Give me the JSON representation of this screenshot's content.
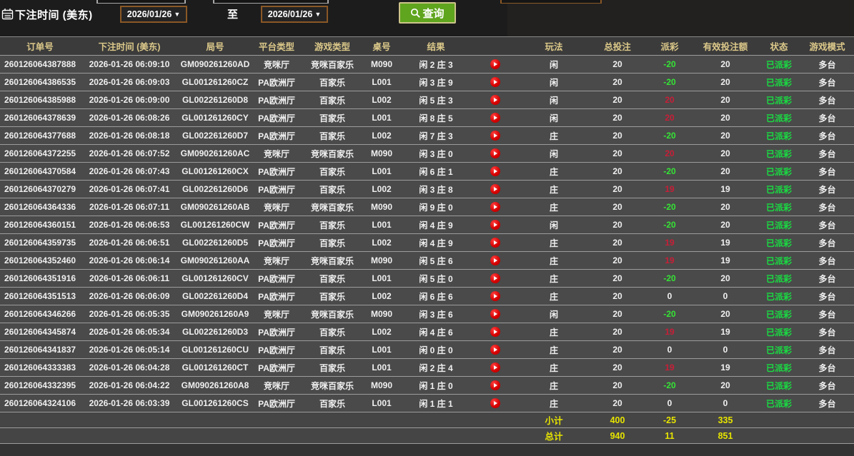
{
  "toolbar": {
    "label": "下注时间 (美东)",
    "date_from": "2026/01/26",
    "date_to": "2026/01/26",
    "to_label": "至",
    "search_label": "查询",
    "dropdown_arrow": "▼"
  },
  "table": {
    "headers": [
      "订单号",
      "下注时间 (美东)",
      "局号",
      "平台类型",
      "游戏类型",
      "桌号",
      "结果",
      "",
      "玩法",
      "总投注",
      "派彩",
      "有效投注额",
      "状态",
      "游戏模式"
    ],
    "rows": [
      [
        "260126064387888",
        "2026-01-26 06:09:10",
        "GM090261260AD",
        "竞咪厅",
        "竞咪百家乐",
        "M090",
        "闲 2 庄 3",
        "闲",
        "20",
        "-20",
        "20",
        "已派彩",
        "多台"
      ],
      [
        "260126064386535",
        "2026-01-26 06:09:03",
        "GL001261260CZ",
        "PA欧洲厅",
        "百家乐",
        "L001",
        "闲 3 庄 9",
        "闲",
        "20",
        "-20",
        "20",
        "已派彩",
        "多台"
      ],
      [
        "260126064385988",
        "2026-01-26 06:09:00",
        "GL002261260D8",
        "PA欧洲厅",
        "百家乐",
        "L002",
        "闲 5 庄 3",
        "闲",
        "20",
        "20",
        "20",
        "已派彩",
        "多台"
      ],
      [
        "260126064378639",
        "2026-01-26 06:08:26",
        "GL001261260CY",
        "PA欧洲厅",
        "百家乐",
        "L001",
        "闲 8 庄 5",
        "闲",
        "20",
        "20",
        "20",
        "已派彩",
        "多台"
      ],
      [
        "260126064377688",
        "2026-01-26 06:08:18",
        "GL002261260D7",
        "PA欧洲厅",
        "百家乐",
        "L002",
        "闲 7 庄 3",
        "庄",
        "20",
        "-20",
        "20",
        "已派彩",
        "多台"
      ],
      [
        "260126064372255",
        "2026-01-26 06:07:52",
        "GM090261260AC",
        "竞咪厅",
        "竞咪百家乐",
        "M090",
        "闲 3 庄 0",
        "闲",
        "20",
        "20",
        "20",
        "已派彩",
        "多台"
      ],
      [
        "260126064370584",
        "2026-01-26 06:07:43",
        "GL001261260CX",
        "PA欧洲厅",
        "百家乐",
        "L001",
        "闲 6 庄 1",
        "庄",
        "20",
        "-20",
        "20",
        "已派彩",
        "多台"
      ],
      [
        "260126064370279",
        "2026-01-26 06:07:41",
        "GL002261260D6",
        "PA欧洲厅",
        "百家乐",
        "L002",
        "闲 3 庄 8",
        "庄",
        "20",
        "19",
        "19",
        "已派彩",
        "多台"
      ],
      [
        "260126064364336",
        "2026-01-26 06:07:11",
        "GM090261260AB",
        "竞咪厅",
        "竞咪百家乐",
        "M090",
        "闲 9 庄 0",
        "庄",
        "20",
        "-20",
        "20",
        "已派彩",
        "多台"
      ],
      [
        "260126064360151",
        "2026-01-26 06:06:53",
        "GL001261260CW",
        "PA欧洲厅",
        "百家乐",
        "L001",
        "闲 4 庄 9",
        "闲",
        "20",
        "-20",
        "20",
        "已派彩",
        "多台"
      ],
      [
        "260126064359735",
        "2026-01-26 06:06:51",
        "GL002261260D5",
        "PA欧洲厅",
        "百家乐",
        "L002",
        "闲 4 庄 9",
        "庄",
        "20",
        "19",
        "19",
        "已派彩",
        "多台"
      ],
      [
        "260126064352460",
        "2026-01-26 06:06:14",
        "GM090261260AA",
        "竞咪厅",
        "竞咪百家乐",
        "M090",
        "闲 5 庄 6",
        "庄",
        "20",
        "19",
        "19",
        "已派彩",
        "多台"
      ],
      [
        "260126064351916",
        "2026-01-26 06:06:11",
        "GL001261260CV",
        "PA欧洲厅",
        "百家乐",
        "L001",
        "闲 5 庄 0",
        "庄",
        "20",
        "-20",
        "20",
        "已派彩",
        "多台"
      ],
      [
        "260126064351513",
        "2026-01-26 06:06:09",
        "GL002261260D4",
        "PA欧洲厅",
        "百家乐",
        "L002",
        "闲 6 庄 6",
        "庄",
        "20",
        "0",
        "0",
        "已派彩",
        "多台"
      ],
      [
        "260126064346266",
        "2026-01-26 06:05:35",
        "GM090261260A9",
        "竞咪厅",
        "竞咪百家乐",
        "M090",
        "闲 3 庄 6",
        "闲",
        "20",
        "-20",
        "20",
        "已派彩",
        "多台"
      ],
      [
        "260126064345874",
        "2026-01-26 06:05:34",
        "GL002261260D3",
        "PA欧洲厅",
        "百家乐",
        "L002",
        "闲 4 庄 6",
        "庄",
        "20",
        "19",
        "19",
        "已派彩",
        "多台"
      ],
      [
        "260126064341837",
        "2026-01-26 06:05:14",
        "GL001261260CU",
        "PA欧洲厅",
        "百家乐",
        "L001",
        "闲 0 庄 0",
        "庄",
        "20",
        "0",
        "0",
        "已派彩",
        "多台"
      ],
      [
        "260126064333383",
        "2026-01-26 06:04:28",
        "GL001261260CT",
        "PA欧洲厅",
        "百家乐",
        "L001",
        "闲 2 庄 4",
        "庄",
        "20",
        "19",
        "19",
        "已派彩",
        "多台"
      ],
      [
        "260126064332395",
        "2026-01-26 06:04:22",
        "GM090261260A8",
        "竞咪厅",
        "竞咪百家乐",
        "M090",
        "闲 1 庄 0",
        "庄",
        "20",
        "-20",
        "20",
        "已派彩",
        "多台"
      ],
      [
        "260126064324106",
        "2026-01-26 06:03:39",
        "GL001261260CS",
        "PA欧洲厅",
        "百家乐",
        "L001",
        "闲 1 庄 1",
        "庄",
        "20",
        "0",
        "0",
        "已派彩",
        "多台"
      ]
    ],
    "subtotal": {
      "label": "小计",
      "bet": "400",
      "payout": "-25",
      "valid": "335"
    },
    "total": {
      "label": "总计",
      "bet": "940",
      "payout": "11",
      "valid": "851"
    }
  },
  "colors": {
    "payout_positive": "#c81e37",
    "payout_negative": "#35e535",
    "status_paid": "#19dd42",
    "summary_text": "#e6e400",
    "header_text": "#dcc98a",
    "button_green": "#5fa51e",
    "button_border": "#cdc48b",
    "select_border": "#8a5826",
    "row_bg": "#4a4a4a",
    "row_line": "#9c9c9c"
  }
}
